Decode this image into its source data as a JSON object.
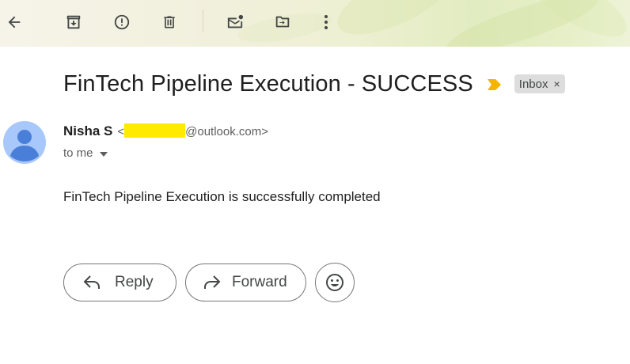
{
  "toolbar": {
    "icons": [
      "back-arrow-icon",
      "archive-icon",
      "report-spam-icon",
      "delete-icon",
      "mark-unread-icon",
      "move-to-icon",
      "more-options-icon"
    ]
  },
  "email": {
    "subject": "FinTech Pipeline Execution - SUCCESS",
    "label": "Inbox",
    "label_remove": "×",
    "sender_name": "Nisha S",
    "sender_email_prefix": "<",
    "sender_email_domain": "@outlook.com>",
    "recipient": "to me",
    "body": "FinTech Pipeline Execution is successfully completed"
  },
  "actions": {
    "reply_label": "Reply",
    "forward_label": "Forward"
  },
  "colors": {
    "important_marker": "#f4b400",
    "avatar_bg": "#a8c7fa",
    "avatar_fg": "#4a7fd9",
    "redaction": "#ffea00"
  }
}
